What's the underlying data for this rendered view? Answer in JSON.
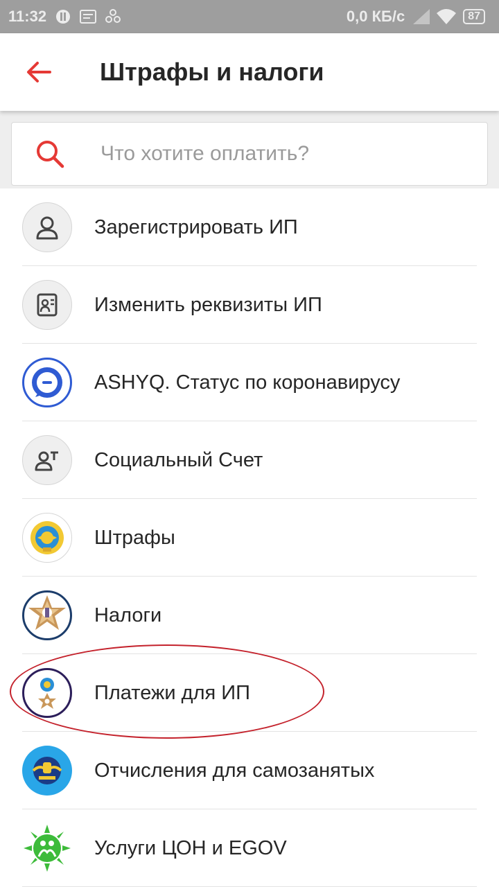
{
  "status_bar": {
    "time": "11:32",
    "network_speed": "0,0 КБ/с",
    "battery": "87"
  },
  "app_bar": {
    "title": "Штрафы и налоги"
  },
  "search": {
    "placeholder": "Что хотите оплатить?"
  },
  "list": {
    "items": [
      {
        "label": "Зарегистрировать ИП",
        "icon": "person-icon"
      },
      {
        "label": "Изменить реквизиты ИП",
        "icon": "document-person-icon"
      },
      {
        "label": "ASHYQ. Статус по коронавирусу",
        "icon": "ashyq-chat-icon"
      },
      {
        "label": "Социальный Счет",
        "icon": "person-lines-icon"
      },
      {
        "label": "Штрафы",
        "icon": "emblem-icon"
      },
      {
        "label": "Налоги",
        "icon": "tax-emblem-icon"
      },
      {
        "label": "Платежи для ИП",
        "icon": "combined-emblem-icon"
      },
      {
        "label": "Отчисления для самозанятых",
        "icon": "blue-emblem-icon"
      },
      {
        "label": "Услуги ЦОН и EGOV",
        "icon": "green-sun-icon"
      }
    ]
  },
  "colors": {
    "accent": "#e53935",
    "status_bar": "#9e9e9e",
    "highlight": "#c4222c"
  }
}
